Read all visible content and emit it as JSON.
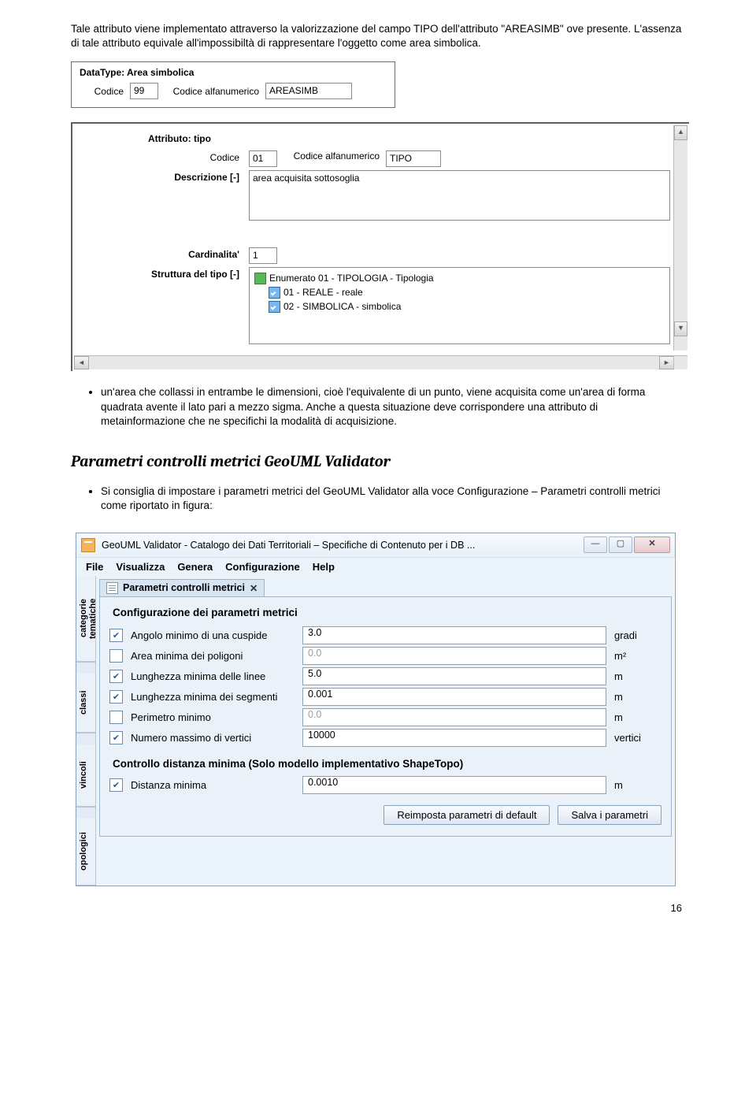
{
  "para1": "Tale attributo viene implementato attraverso la valorizzazione del campo TIPO dell'attributo \"AREASIMB\" ove presente. L'assenza di tale attributo equivale all'impossibiltà di rappresentare l'oggetto come area simbolica.",
  "panel1": {
    "title": "DataType: Area simbolica",
    "codice_label": "Codice",
    "codice_value": "99",
    "codalfa_label": "Codice alfanumerico",
    "codalfa_value": "AREASIMB"
  },
  "panel2": {
    "title": "Attributo: tipo",
    "codice_label": "Codice",
    "codice_value": "01",
    "codalfa_label": "Codice alfanumerico",
    "codalfa_value": "TIPO",
    "descr_label": "Descrizione [-]",
    "descr_value": "area acquisita sottosoglia",
    "card_label": "Cardinalita'",
    "card_value": "1",
    "strut_label": "Struttura del tipo [-]",
    "tree_root": "Enumerato 01 - TIPOLOGIA - Tipologia",
    "tree_c1": "01 - REALE - reale",
    "tree_c2": "02 - SIMBOLICA - simbolica"
  },
  "bullet2": "un'area che collassi in entrambe le dimensioni, cioè l'equivalente di un punto, viene acquisita come un'area di forma quadrata avente il lato pari a mezzo sigma. Anche a questa situazione deve corrispondere una attributo di metainformazione che ne specifichi la modalità di acquisizione.",
  "heading": "Parametri controlli metrici GeoUML Validator",
  "bullet3": "Si consiglia di impostare i parametri metrici del GeoUML Validator alla voce Configurazione – Parametri controlli metrici come riportato in figura:",
  "win": {
    "title": "GeoUML Validator - Catalogo dei Dati Territoriali – Specifiche di Contenuto per i DB ...",
    "menu": [
      "File",
      "Visualizza",
      "Genera",
      "Configurazione",
      "Help"
    ],
    "sidetabs": [
      "categorie tematiche",
      "classi",
      "vincoli",
      "opologici"
    ],
    "doctab": "Parametri controlli metrici",
    "form_title": "Configurazione dei parametri metrici",
    "rows": [
      {
        "checked": true,
        "label": "Angolo minimo di una cuspide",
        "value": "3.0",
        "unit": "gradi",
        "disabled": false
      },
      {
        "checked": false,
        "label": "Area minima dei poligoni",
        "value": "0.0",
        "unit": "m²",
        "disabled": true
      },
      {
        "checked": true,
        "label": "Lunghezza minima delle linee",
        "value": "5.0",
        "unit": "m",
        "disabled": false
      },
      {
        "checked": true,
        "label": "Lunghezza minima dei segmenti",
        "value": "0.001",
        "unit": "m",
        "disabled": false
      },
      {
        "checked": false,
        "label": "Perimetro minimo",
        "value": "0.0",
        "unit": "m",
        "disabled": true
      },
      {
        "checked": true,
        "label": "Numero massimo di vertici",
        "value": "10000",
        "unit": "vertici",
        "disabled": false
      }
    ],
    "subtitle": "Controllo distanza minima (Solo modello implementativo ShapeTopo)",
    "dist_row": {
      "checked": true,
      "label": "Distanza minima",
      "value": "0.0010",
      "unit": "m"
    },
    "btn_reset": "Reimposta parametri di default",
    "btn_save": "Salva i parametri"
  },
  "page_number": "16"
}
